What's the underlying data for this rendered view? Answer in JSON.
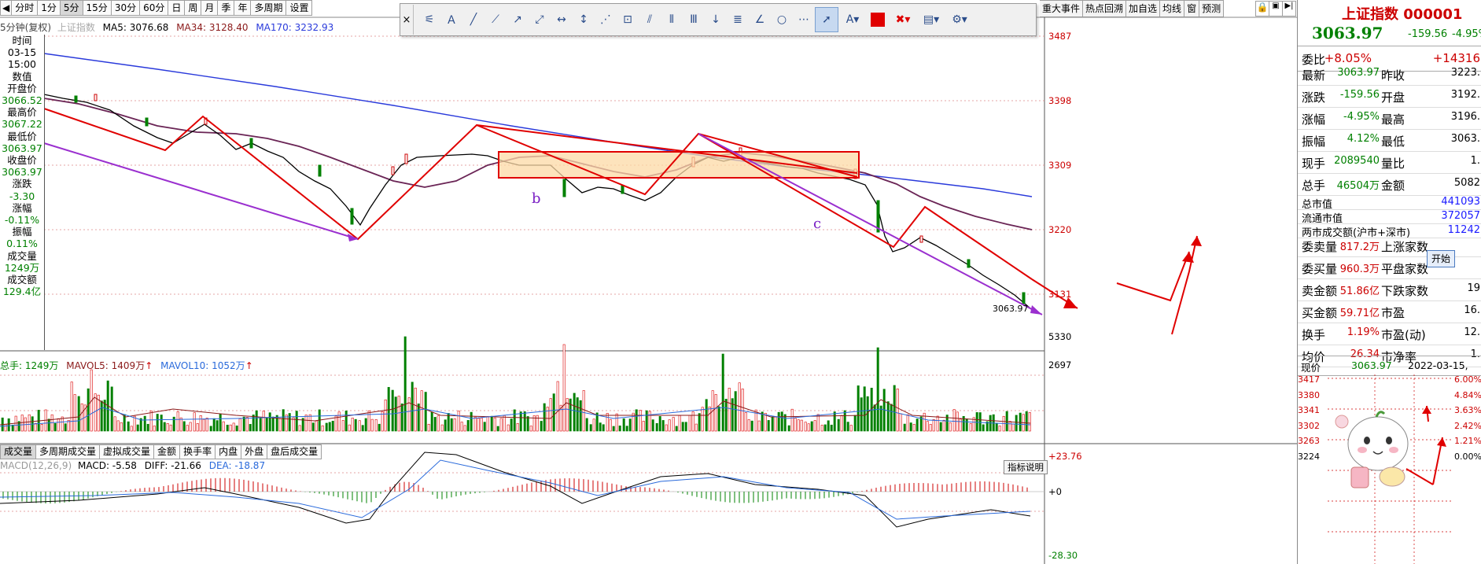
{
  "period_tabs": [
    {
      "label": "分时",
      "active": false
    },
    {
      "label": "1分",
      "active": false
    },
    {
      "label": "5分",
      "active": true
    },
    {
      "label": "15分",
      "active": false
    },
    {
      "label": "30分",
      "active": false
    },
    {
      "label": "60分",
      "active": false
    },
    {
      "label": "日",
      "active": false
    },
    {
      "label": "周",
      "active": false
    },
    {
      "label": "月",
      "active": false
    },
    {
      "label": "季",
      "active": false
    },
    {
      "label": "年",
      "active": false
    },
    {
      "label": "多周期",
      "active": false
    },
    {
      "label": "设置",
      "active": false
    }
  ],
  "right_tabs": [
    "重大事件",
    "热点回溯",
    "加自选",
    "均线",
    "窗",
    "预测"
  ],
  "toolbar": {
    "close": "×",
    "color": "#e00000"
  },
  "chart": {
    "title": "5分钟(复权)",
    "index_name": "上证指数",
    "ma5": "MA5: 3076.68",
    "ma34": "MA34: 3128.40",
    "ma170": "MA170: 3232.93",
    "price_ticks": [
      "3487",
      "3398",
      "3309",
      "3220",
      "3131"
    ],
    "last_label": "3063.97",
    "wave_b": "b",
    "wave_c": "c"
  },
  "left_panel": [
    {
      "label": "时间",
      "value": "03-15"
    },
    {
      "label": "",
      "value": "15:00"
    },
    {
      "label": "数值",
      "value": ""
    },
    {
      "label": "开盘价",
      "value": "3066.52"
    },
    {
      "label": "最高价",
      "value": "3067.22"
    },
    {
      "label": "最低价",
      "value": "3063.97"
    },
    {
      "label": "收盘价",
      "value": "3063.97"
    },
    {
      "label": "涨跌",
      "value": "-3.30"
    },
    {
      "label": "涨幅",
      "value": "-0.11%"
    },
    {
      "label": "振幅",
      "value": "0.11%"
    },
    {
      "label": "成交量",
      "value": "1249万"
    },
    {
      "label": "成交额",
      "value": "129.4亿"
    }
  ],
  "volume": {
    "total": "总手: 1249万",
    "mavol5": "MAVOL5: 1409万",
    "mavol10": "MAVOL10: 1052万",
    "ticks": [
      "5330",
      "2697"
    ]
  },
  "indicator_tabs": [
    "成交量",
    "多周期成交量",
    "虚拟成交量",
    "金额",
    "换手率",
    "内盘",
    "外盘",
    "盘后成交量"
  ],
  "macd": {
    "params": "MACD(12,26,9)",
    "macd": "MACD: -5.58",
    "diff": "DIFF: -21.66",
    "dea": "DEA: -18.87",
    "ticks": [
      "+23.76",
      "+0",
      "-28.30"
    ],
    "help": "指标说明"
  },
  "quote": {
    "name": "上证指数 000001",
    "price": "3063.97",
    "change": "-159.56",
    "pct": "-4.95%",
    "weibi_label": "委比",
    "weibi": "+8.05%",
    "weicha": "+14316",
    "rows": [
      {
        "l1": "最新",
        "v1": "3063.97",
        "l2": "昨收",
        "v2": "3223."
      },
      {
        "l1": "涨跌",
        "v1": "-159.56",
        "l2": "开盘",
        "v2": "3192."
      },
      {
        "l1": "涨幅",
        "v1": "-4.95%",
        "l2": "最高",
        "v2": "3196."
      },
      {
        "l1": "振幅",
        "v1": "4.12%",
        "l2": "最低",
        "v2": "3063."
      },
      {
        "l1": "现手",
        "v1": "2089540",
        "l2": "量比",
        "v2": "1."
      },
      {
        "l1": "总手",
        "v1": "46504万",
        "l2": "金额",
        "v2": "5082"
      }
    ],
    "mv": [
      {
        "l": "总市值",
        "v": "441093"
      },
      {
        "l": "流通市值",
        "v": "372057"
      },
      {
        "l": "两市成交额(沪市+深市)",
        "v": "11242"
      }
    ],
    "rows2": [
      {
        "l1": "委卖量",
        "v1": "817.2万",
        "l2": "上涨家数",
        "v2": ""
      },
      {
        "l1": "委买量",
        "v1": "960.3万",
        "l2": "平盘家数",
        "v2": ""
      },
      {
        "l1": "卖金额",
        "v1": "51.86亿",
        "l2": "下跌家数",
        "v2": "19"
      },
      {
        "l1": "买金额",
        "v1": "59.71亿",
        "l2": "市盈",
        "v2": "16."
      },
      {
        "l1": "换手",
        "v1": "1.19%",
        "l2": "市盈(动)",
        "v2": "12."
      },
      {
        "l1": "均价",
        "v1": "26.34",
        "l2": "市净率",
        "v2": "1."
      }
    ],
    "start_btn": "开始",
    "bottom_price_label": "现价",
    "bottom_price": "3063.97",
    "bottom_date": "2022-03-15,",
    "mini_left": [
      "3417",
      "3380",
      "3341",
      "3302",
      "3263",
      "3224"
    ],
    "mini_right": [
      "6.00%",
      "4.84%",
      "3.63%",
      "2.42%",
      "1.21%",
      "0.00%"
    ]
  }
}
